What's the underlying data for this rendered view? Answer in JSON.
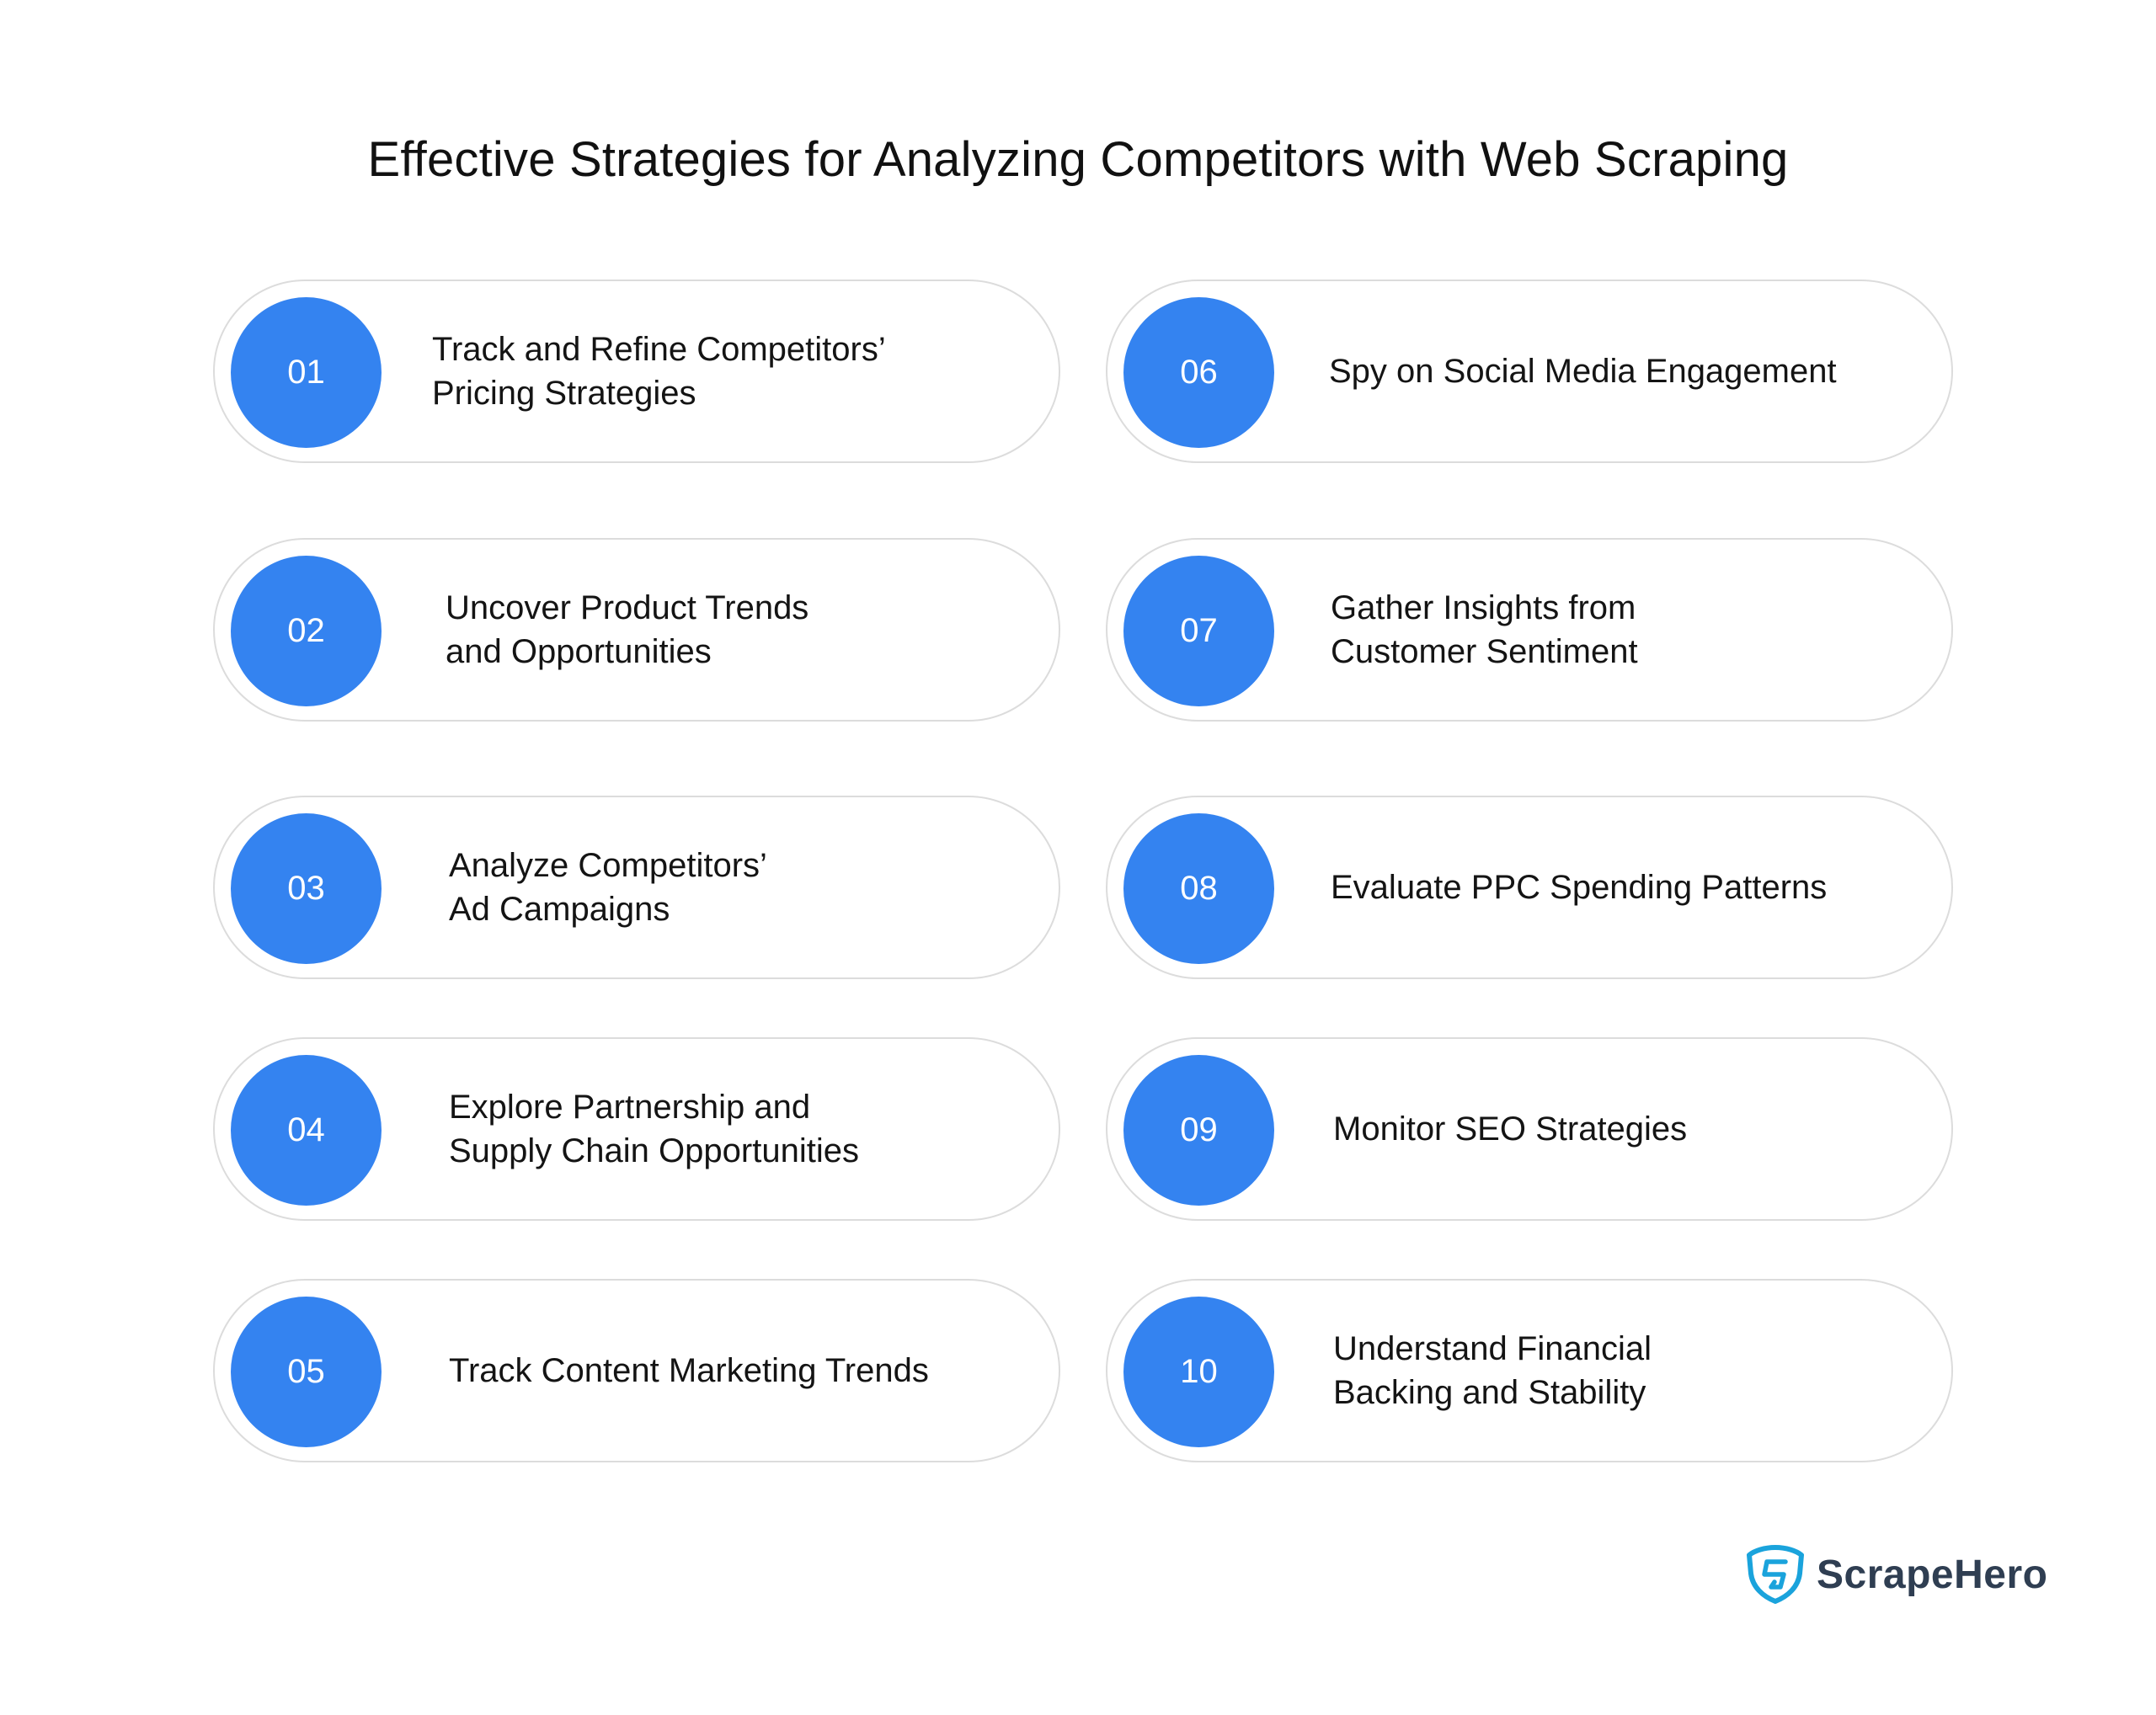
{
  "title": "Effective Strategies for Analyzing Competitors with Web Scraping",
  "colors": {
    "accent": "#3483f0",
    "card_border": "#dcdcdc",
    "brand_text": "#2f3e52",
    "brand_icon": "#1aa3dc"
  },
  "strategies": [
    {
      "number": "01",
      "text": "Track and Refine Competitors’\nPricing Strategies"
    },
    {
      "number": "02",
      "text": "Uncover Product Trends\nand Opportunities"
    },
    {
      "number": "03",
      "text": "Analyze Competitors’\nAd Campaigns"
    },
    {
      "number": "04",
      "text": "Explore Partnership and\nSupply Chain Opportunities"
    },
    {
      "number": "05",
      "text": "Track Content Marketing Trends"
    },
    {
      "number": "06",
      "text": "Spy on Social Media Engagement"
    },
    {
      "number": "07",
      "text": "Gather Insights from\nCustomer Sentiment"
    },
    {
      "number": "08",
      "text": "Evaluate PPC Spending Patterns"
    },
    {
      "number": "09",
      "text": "Monitor SEO Strategies"
    },
    {
      "number": "10",
      "text": "Understand Financial\nBacking and Stability"
    }
  ],
  "brand": {
    "name": "ScrapeHero",
    "icon": "shield-s-icon"
  }
}
